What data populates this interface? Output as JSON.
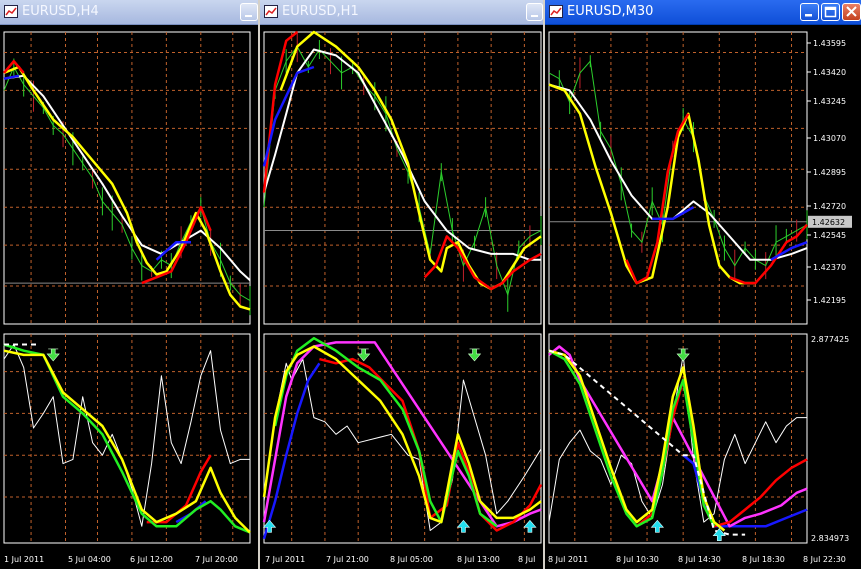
{
  "windows": [
    {
      "title": "EURUSD,H4",
      "x_labels": [
        "1 Jul 2011",
        "5 Jul 04:00",
        "6 Jul 12:00",
        "7 Jul 20:00"
      ]
    },
    {
      "title": "EURUSD,H1",
      "x_labels": [
        "7 Jul 2011",
        "7 Jul 21:00",
        "8 Jul 05:00",
        "8 Jul 13:00",
        "8 Jul"
      ]
    },
    {
      "title": "EURUSD,M30",
      "x_labels": [
        "8 Jul 2011",
        "8 Jul 10:30",
        "8 Jul 14:30",
        "8 Jul 18:30",
        "8 Jul 22:30"
      ],
      "price_labels": [
        "1.43595",
        "1.43420",
        "1.43245",
        "1.43070",
        "1.42895",
        "1.42720",
        "1.42545",
        "1.42370",
        "1.42195"
      ],
      "current_price": "1.42632",
      "indicator_labels": [
        "2.877425",
        "2.834973"
      ]
    }
  ],
  "colors": {
    "background": "#000000",
    "grid": "#c0612b",
    "price_bar": "#2ccf2c",
    "ma_white": "#ffffff",
    "ma_yellow": "#ffff00",
    "ma_red": "#ff0000",
    "ma_blue": "#1818ff",
    "ma_green": "#22ee22",
    "ma_magenta": "#ff33ff",
    "arrow_down": "#44dd44",
    "arrow_up": "#22ddee"
  },
  "icons": {
    "chart_window": "chart-window-icon",
    "minimize": "minimize-icon",
    "maximize": "maximize-icon",
    "close": "close-icon"
  }
}
